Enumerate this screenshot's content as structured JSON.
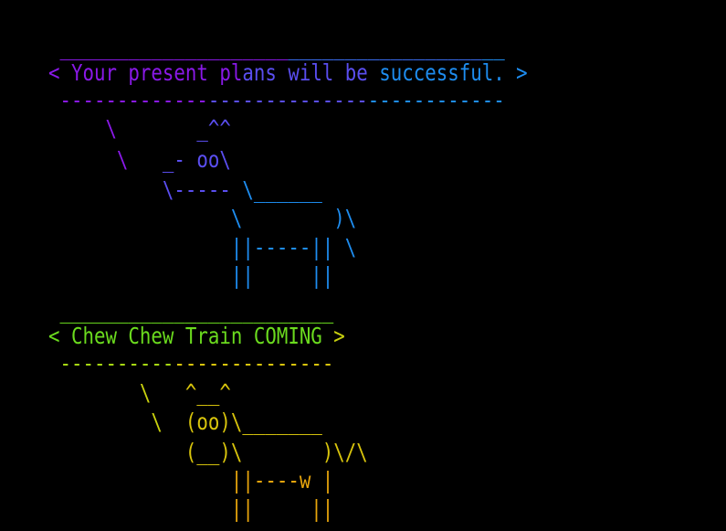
{
  "terminal": {
    "lines": [
      {
        "segments": [
          {
            "text": " ____________________",
            "color": "#8A19E8"
          },
          {
            "text": "_________________",
            "color": "#3A6CF0"
          },
          {
            "text": "__",
            "color": "#1E8DF0"
          }
        ]
      },
      {
        "segments": [
          {
            "text": "< Your present pl",
            "color": "#8A19E8"
          },
          {
            "text": "ans will be ",
            "color": "#5A4EF0"
          },
          {
            "text": "successful. >",
            "color": "#1E8DF0"
          }
        ]
      },
      {
        "segments": [
          {
            "text": " -------------",
            "color": "#8A19E8"
          },
          {
            "text": "--------------",
            "color": "#5A4EF0"
          },
          {
            "text": "------------",
            "color": "#1E8DF0"
          }
        ]
      },
      {
        "segments": [
          {
            "text": "     \\       ",
            "color": "#8A19E8"
          },
          {
            "text": "_^^",
            "color": "#5A4EF0"
          }
        ]
      },
      {
        "segments": [
          {
            "text": "      \\   ",
            "color": "#8A19E8"
          },
          {
            "text": "_- oo\\",
            "color": "#5A4EF0"
          }
        ]
      },
      {
        "segments": [
          {
            "text": "          \\----- ",
            "color": "#5A4EF0"
          },
          {
            "text": "\\______",
            "color": "#1E8DF0"
          }
        ]
      },
      {
        "segments": [
          {
            "text": "                \\        )\\",
            "color": "#1E8DF0"
          }
        ]
      },
      {
        "segments": [
          {
            "text": "                ||-----|| \\",
            "color": "#1E8DF0"
          }
        ]
      },
      {
        "segments": [
          {
            "text": "                ||     ||",
            "color": "#1E8DF0"
          }
        ]
      },
      {
        "segments": [
          {
            "text": " ________________________",
            "color": "#6BDB1E"
          }
        ]
      },
      {
        "segments": [
          {
            "text": "< Chew Chew Train COMING ",
            "color": "#6BDB1E"
          },
          {
            "text": ">",
            "color": "#C9D10E"
          }
        ]
      },
      {
        "segments": [
          {
            "text": " ----------",
            "color": "#A6D812"
          },
          {
            "text": "--------------",
            "color": "#D8C40C"
          }
        ]
      },
      {
        "segments": [
          {
            "text": "        \\   ",
            "color": "#C9D10E"
          },
          {
            "text": "^__^",
            "color": "#D8C40C"
          }
        ]
      },
      {
        "segments": [
          {
            "text": "         \\  ",
            "color": "#C9D10E"
          },
          {
            "text": "(oo)\\_______",
            "color": "#D8C40C"
          }
        ]
      },
      {
        "segments": [
          {
            "text": "            ",
            "color": "#C9D10E"
          },
          {
            "text": "(__)\\       )\\/\\",
            "color": "#D8C40C"
          }
        ]
      },
      {
        "segments": [
          {
            "text": "                ||----w |",
            "color": "#E8A50C"
          }
        ]
      },
      {
        "segments": [
          {
            "text": "                ||     ||",
            "color": "#E8A50C"
          }
        ]
      }
    ]
  }
}
